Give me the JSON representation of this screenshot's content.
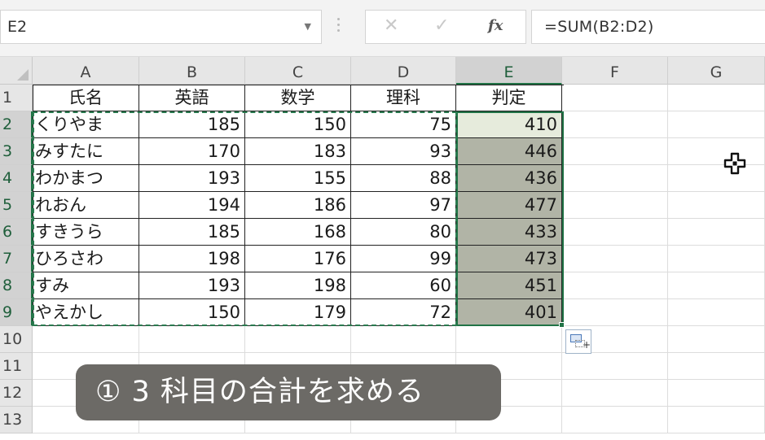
{
  "formula_bar": {
    "name_box": "E2",
    "cancel_glyph": "✕",
    "enter_glyph": "✓",
    "fx_label": "fx",
    "formula": "=SUM(B2:D2)"
  },
  "sheet": {
    "columns": [
      "A",
      "B",
      "C",
      "D",
      "E",
      "F",
      "G"
    ],
    "row_numbers": [
      "1",
      "2",
      "3",
      "4",
      "5",
      "6",
      "7",
      "8",
      "9",
      "10",
      "11",
      "12",
      "13"
    ],
    "headers": [
      "氏名",
      "英語",
      "数学",
      "理科",
      "判定"
    ],
    "rows": [
      [
        "くりやま",
        "185",
        "150",
        "75",
        "410"
      ],
      [
        "みすたに",
        "170",
        "183",
        "93",
        "446"
      ],
      [
        "わかまつ",
        "193",
        "155",
        "88",
        "436"
      ],
      [
        "れおん",
        "194",
        "186",
        "97",
        "477"
      ],
      [
        "すきうら",
        "185",
        "168",
        "80",
        "433"
      ],
      [
        "ひろさわ",
        "198",
        "176",
        "99",
        "473"
      ],
      [
        "すみ",
        "193",
        "198",
        "60",
        "451"
      ],
      [
        "やえかし",
        "150",
        "179",
        "72",
        "401"
      ]
    ],
    "selected_column": "E",
    "active_cell": "E2"
  },
  "icons": {
    "cursor": "cell-cross-cursor-icon",
    "quick_analysis": "quick-analysis-icon",
    "name_box_dropdown": "chevron-down-icon"
  },
  "banner": {
    "text": "① 3 科目の合計を求める"
  },
  "colors": {
    "selection_green": "#217346",
    "selection_fill": "#b1b4a6",
    "banner_bg": "#6c6a66"
  }
}
